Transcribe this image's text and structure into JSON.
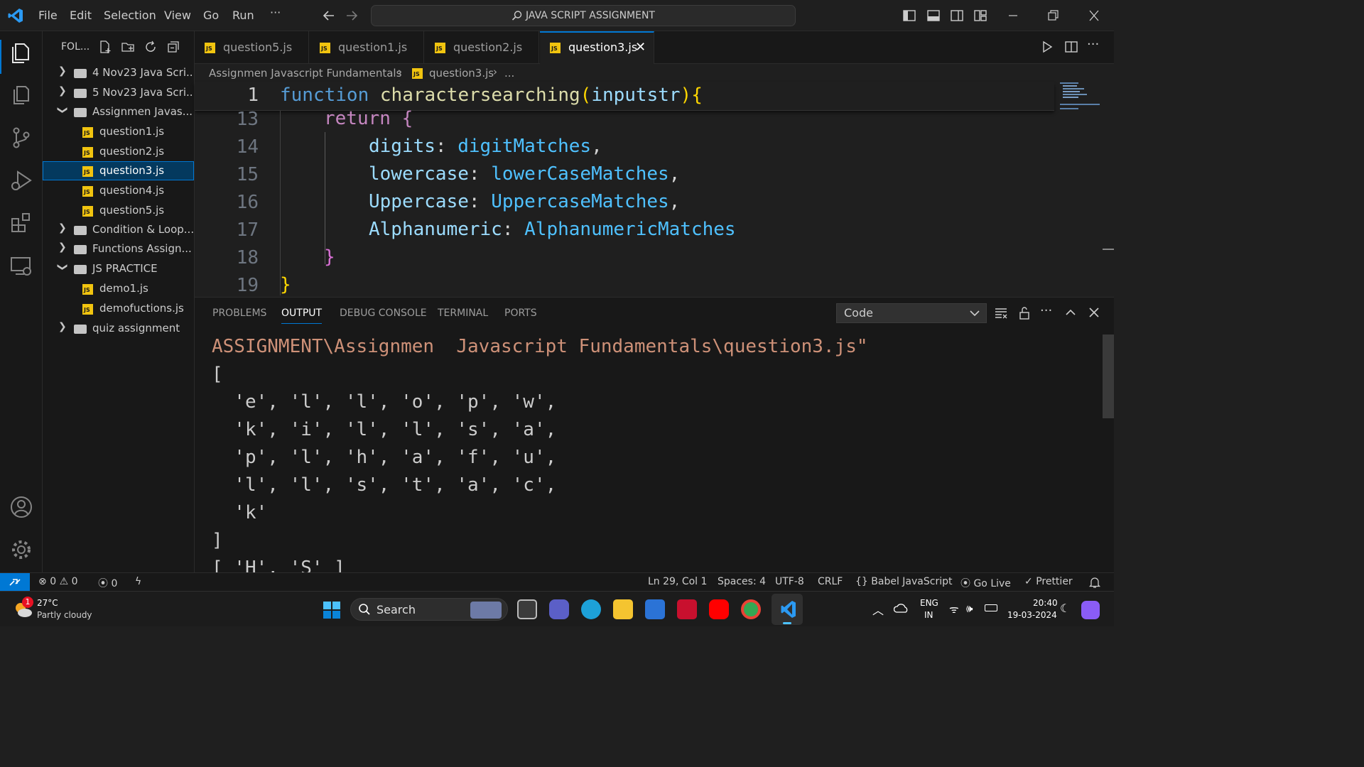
{
  "window": {
    "title": "JAVA SCRIPT ASSIGNMENT",
    "menu": [
      "File",
      "Edit",
      "Selection",
      "View",
      "Go",
      "Run",
      "···"
    ]
  },
  "explorer": {
    "header": "FOL...",
    "items": [
      {
        "label": "4 Nov23 Java Scri...",
        "type": "folder",
        "expanded": false
      },
      {
        "label": "5 Nov23 Java Scri...",
        "type": "folder",
        "expanded": false
      },
      {
        "label": "Assignmen  Javas...",
        "type": "folder",
        "expanded": true
      },
      {
        "label": "question1.js",
        "type": "file"
      },
      {
        "label": "question2.js",
        "type": "file"
      },
      {
        "label": "question3.js",
        "type": "file",
        "selected": true
      },
      {
        "label": "question4.js",
        "type": "file"
      },
      {
        "label": "question5.js",
        "type": "file"
      },
      {
        "label": "Condition & Loop...",
        "type": "folder",
        "expanded": false
      },
      {
        "label": "Functions Assign...",
        "type": "folder",
        "expanded": false
      },
      {
        "label": "JS PRACTICE",
        "type": "folder",
        "expanded": true
      },
      {
        "label": "demo1.js",
        "type": "file"
      },
      {
        "label": "demofuctions.js",
        "type": "file"
      },
      {
        "label": "quiz assignment",
        "type": "folder",
        "expanded": false
      }
    ]
  },
  "tabs": [
    {
      "label": "question5.js",
      "active": false
    },
    {
      "label": "question1.js",
      "active": false
    },
    {
      "label": "question2.js",
      "active": false
    },
    {
      "label": "question3.js",
      "active": true
    }
  ],
  "breadcrumb": {
    "folder": "Assignmen  Javascript Fundamentals",
    "file": "question3.js",
    "more": "..."
  },
  "editor": {
    "sticky": {
      "num": "1",
      "fn_kw": "function",
      "fn_name": "charactersearching",
      "param": "inputstr"
    },
    "lines": [
      {
        "num": "13",
        "text": "return {"
      },
      {
        "num": "14",
        "key": "digits",
        "value": "digitMatches"
      },
      {
        "num": "15",
        "key": "lowercase",
        "value": "lowerCaseMatches"
      },
      {
        "num": "16",
        "key": "Uppercase",
        "value": "UppercaseMatches"
      },
      {
        "num": "17",
        "key": "Alphanumeric",
        "value": "AlphanumericMatches"
      },
      {
        "num": "18",
        "text": "}"
      },
      {
        "num": "19",
        "text": "}"
      }
    ]
  },
  "panel": {
    "tabs": [
      "PROBLEMS",
      "OUTPUT",
      "DEBUG CONSOLE",
      "TERMINAL",
      "PORTS"
    ],
    "active_tab": "OUTPUT",
    "channel": "Code",
    "output_lines": [
      "ASSIGNMENT\\Assignmen  Javascript Fundamentals\\question3.js\"",
      "[",
      "  'e', 'l', 'l', 'o', 'p', 'w',",
      "  'k', 'i', 'l', 'l', 's', 'a',",
      "  'p', 'l', 'h', 'a', 'f', 'u',",
      "  'l', 'l', 's', 't', 'a', 'c',",
      "  'k'",
      "]",
      "[ 'H', 'S' ]"
    ]
  },
  "statusbar": {
    "errors": "0",
    "warnings": "0",
    "ports": "0",
    "position": "Ln 29, Col 1",
    "spaces": "Spaces: 4",
    "encoding": "UTF-8",
    "eol": "CRLF",
    "language": "Babel JavaScript",
    "golive": "Go Live",
    "prettier": "Prettier"
  },
  "taskbar": {
    "weather_temp": "27°C",
    "weather_desc": "Partly cloudy",
    "weather_badge": "1",
    "search": "Search",
    "lang_top": "ENG",
    "lang_bottom": "IN",
    "time": "20:40",
    "date": "19-03-2024"
  },
  "colors": {
    "accent": "#0078d4",
    "js_icon": "#f1c40f",
    "output_path": "#ce9178"
  }
}
